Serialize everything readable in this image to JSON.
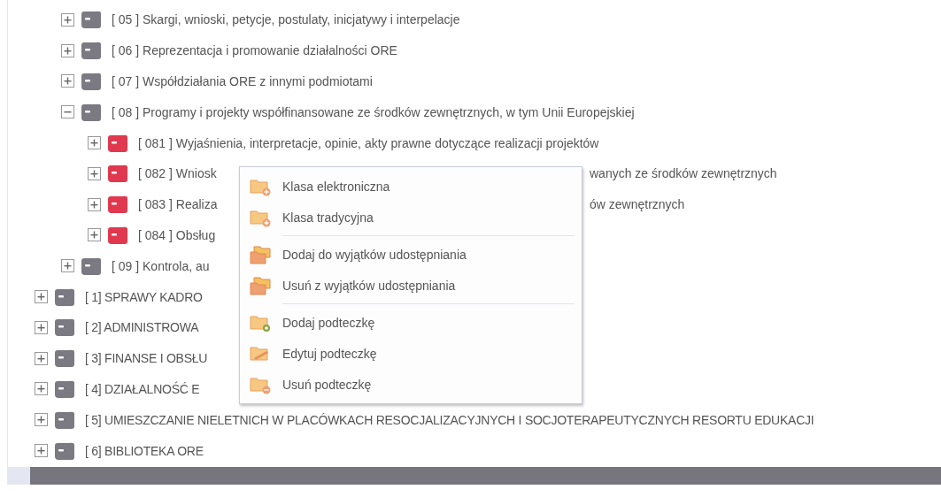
{
  "tree": {
    "partial_branch": [
      {
        "code": "[  05 ]",
        "label": "Skargi, wnioski, petycje, postulaty, inicjatywy i interpelacje",
        "color": "#7b7a83",
        "expanded": false
      },
      {
        "code": "[  06 ]",
        "label": "Reprezentacja i promowanie działalności ORE",
        "color": "#7b7a83",
        "expanded": false
      },
      {
        "code": "[  07 ]",
        "label": "Współdziałania ORE z innymi podmiotami",
        "color": "#7b7a83",
        "expanded": false
      },
      {
        "code": "[  08 ]",
        "label": "Programy i projekty współfinansowane ze środków zewnętrznych, w tym Unii Europejskiej",
        "color": "#7b7a83",
        "expanded": true,
        "children": [
          {
            "code": "[ 081 ]",
            "label": "Wyjaśnienia, interpretacje, opinie, akty prawne dotyczące realizacji projektów",
            "color": "#e0394f",
            "expanded": false
          },
          {
            "code": "[ 082 ]",
            "label": "Wniosk",
            "tail": "wanych ze środków zewnętrznych",
            "color": "#e0394f",
            "expanded": false
          },
          {
            "code": "[ 083 ]",
            "label": "Realiza",
            "tail": "ów zewnętrznych",
            "color": "#e0394f",
            "expanded": false
          },
          {
            "code": "[ 084 ]",
            "label": "Obsług",
            "color": "#e0394f",
            "expanded": false
          }
        ]
      },
      {
        "code": "[  09 ]",
        "label": "Kontrola, au",
        "color": "#7b7a83",
        "expanded": false
      }
    ],
    "items": [
      {
        "code": "[    1]",
        "label": "SPRAWY KADRO",
        "color": "#7b7a83",
        "expanded": false
      },
      {
        "code": "[    2]",
        "label": "ADMINISTROWA",
        "color": "#7b7a83",
        "expanded": false
      },
      {
        "code": "[    3]",
        "label": "FINANSE I OBSŁU",
        "color": "#7b7a83",
        "expanded": false
      },
      {
        "code": "[    4]",
        "label": "DZIAŁALNOŚĆ E",
        "color": "#7b7a83",
        "expanded": false
      },
      {
        "code": "[    5]",
        "label": "UMIESZCZANIE NIELETNICH W PLACÓWKACH RESOCJALIZACYJNYCH I SOCJOTERAPEUTYCZNYCH RESORTU EDUKACJI",
        "color": "#7b7a83",
        "expanded": false
      },
      {
        "code": "[    6]",
        "label": "BIBLIOTEKA ORE",
        "color": "#7b7a83",
        "expanded": false
      }
    ]
  },
  "context_menu": {
    "sections": [
      [
        {
          "label": "Klasa elektroniczna",
          "kind": "class"
        },
        {
          "label": "Klasa tradycyjna",
          "kind": "class"
        }
      ],
      [
        {
          "label": "Dodaj do wyjątków udostępniania",
          "kind": "share"
        },
        {
          "label": "Usuń z wyjątków udostępniania",
          "kind": "share"
        }
      ],
      [
        {
          "label": "Dodaj podteczkę",
          "kind": "folder-add"
        },
        {
          "label": "Edytuj podteczkę",
          "kind": "folder-edit"
        },
        {
          "label": "Usuń podteczkę",
          "kind": "folder-remove"
        }
      ]
    ]
  }
}
